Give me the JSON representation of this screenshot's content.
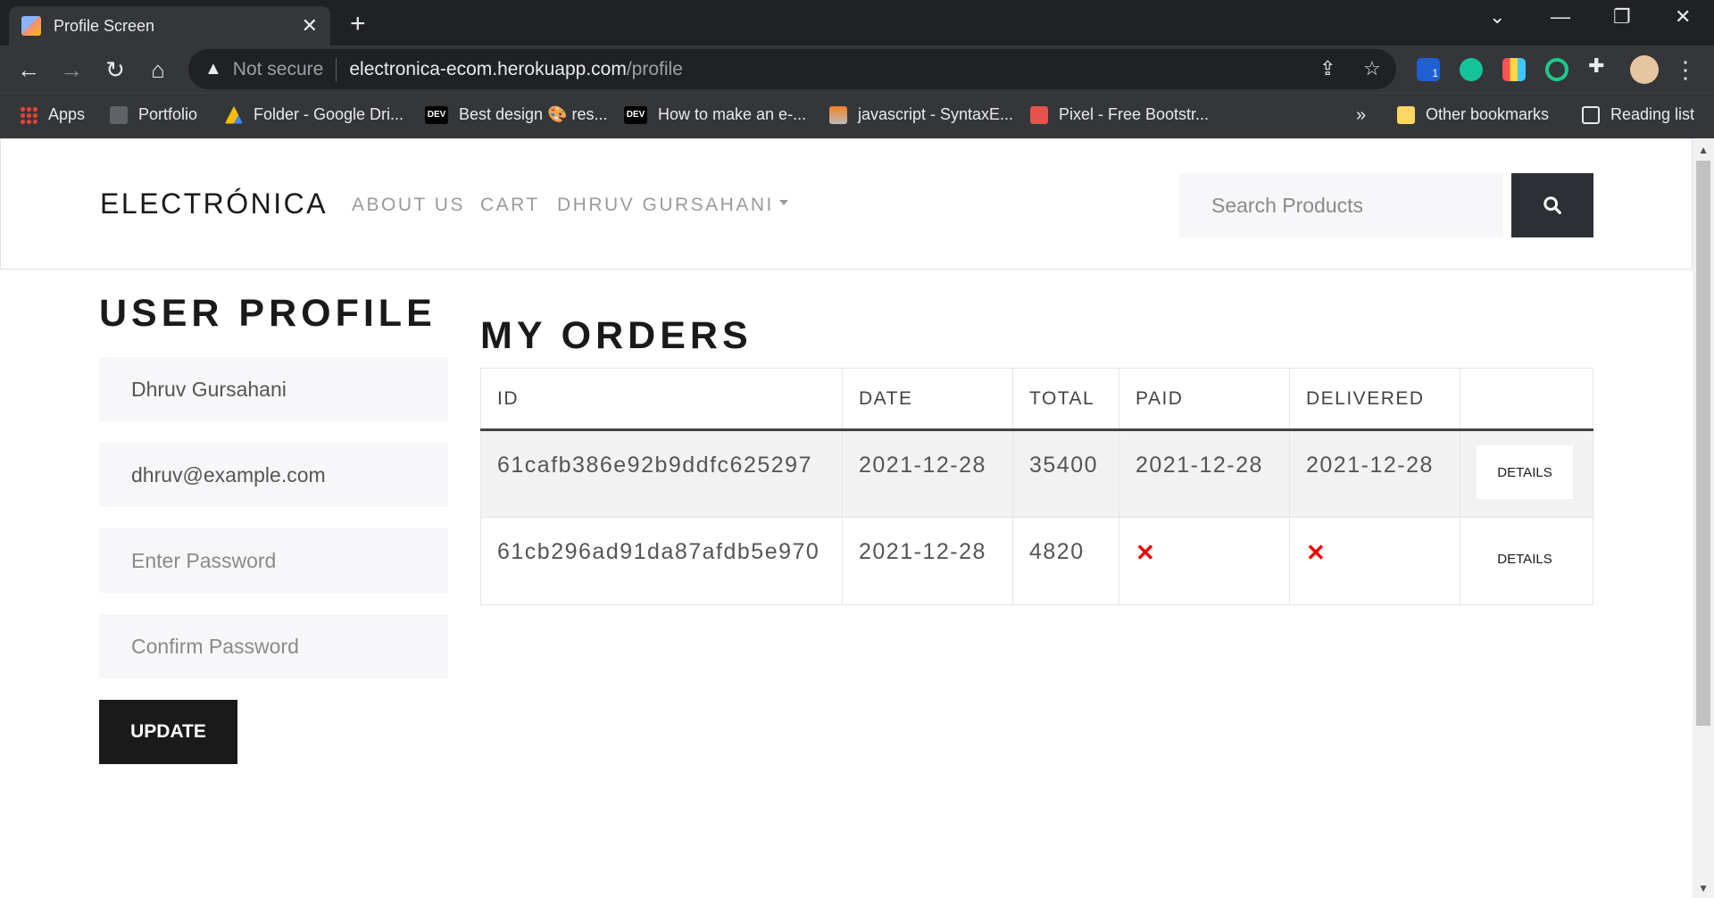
{
  "browser": {
    "tab_title": "Profile Screen",
    "new_tab_symbol": "+",
    "tab_close_symbol": "✕",
    "not_secure": "Not secure",
    "url_host": "electronica-ecom.herokuapp.com",
    "url_path": "/profile",
    "extension_badge": "1",
    "bookmarks": [
      {
        "label": "Apps",
        "icon": "apps-grid-icon"
      },
      {
        "label": "Portfolio",
        "icon": "portfolio-icon"
      },
      {
        "label": "Folder - Google Dri...",
        "icon": "google-drive-icon"
      },
      {
        "label": "Best design 🎨 res...",
        "icon": "dev-icon"
      },
      {
        "label": "How to make an e-...",
        "icon": "dev-icon"
      },
      {
        "label": "javascript - SyntaxE...",
        "icon": "stackoverflow-icon"
      },
      {
        "label": "Pixel - Free Bootstr...",
        "icon": "pixel-icon"
      }
    ],
    "overflow_symbol": "»",
    "other_bookmarks": "Other bookmarks",
    "reading_list": "Reading list"
  },
  "nav": {
    "brand": "ELECTRÓNICA",
    "about": "ABOUT US",
    "cart": "CART",
    "user": "DHRUV GURSAHANI",
    "search_placeholder": "Search Products"
  },
  "profile": {
    "heading": "USER PROFILE",
    "name_value": "Dhruv Gursahani",
    "email_value": "dhruv@example.com",
    "password_placeholder": "Enter Password",
    "confirm_placeholder": "Confirm Password",
    "update_label": "UPDATE"
  },
  "orders": {
    "heading": "MY ORDERS",
    "columns": [
      "ID",
      "DATE",
      "TOTAL",
      "PAID",
      "DELIVERED",
      ""
    ],
    "rows": [
      {
        "id": "61cafb386e92b9ddfc625297",
        "date": "2021-12-28",
        "total": "35400",
        "paid": "2021-12-28",
        "delivered": "2021-12-28",
        "details": "DETAILS"
      },
      {
        "id": "61cb296ad91da87afdb5e970",
        "date": "2021-12-28",
        "total": "4820",
        "paid": "✕",
        "delivered": "✕",
        "details": "DETAILS"
      }
    ]
  },
  "colors": {
    "accent_dark": "#1a1a1a",
    "search_button": "#2c3036",
    "not_paid_mark": "#e00000"
  }
}
